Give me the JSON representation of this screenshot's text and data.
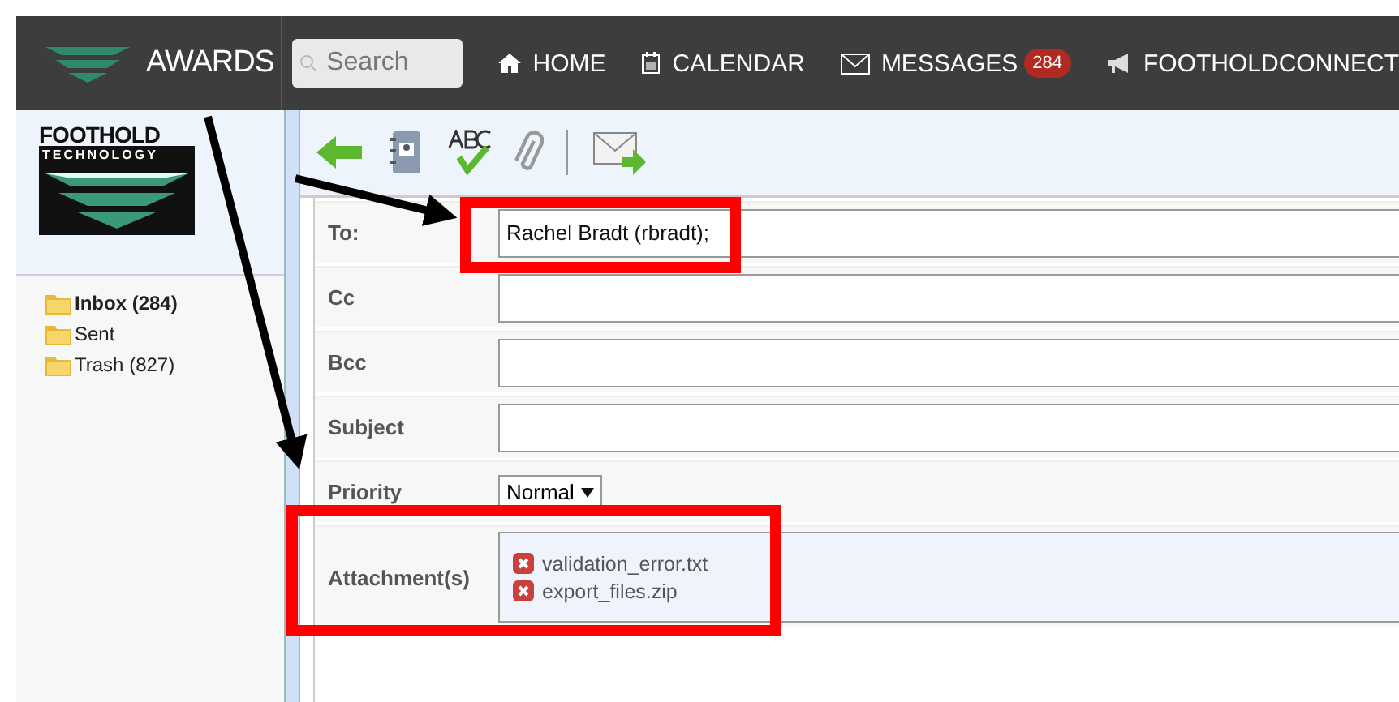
{
  "topbar": {
    "brand": "AWARDS",
    "search": {
      "placeholder": "Search"
    },
    "nav": [
      {
        "kind": "home",
        "label": "HOME"
      },
      {
        "kind": "calendar",
        "label": "CALENDAR"
      },
      {
        "kind": "messages",
        "label": "MESSAGES",
        "badge": "284"
      },
      {
        "kind": "connect",
        "label": "FOOTHOLDCONNECT"
      }
    ]
  },
  "sidebar": {
    "logo": {
      "line1": "FOOTHOLD",
      "line2": "TECHNOLOGY"
    },
    "folders": [
      {
        "name": "Inbox",
        "count": "(284)",
        "bold": true
      },
      {
        "name": "Sent",
        "bold": false
      },
      {
        "name": "Trash",
        "count": "(827)",
        "bold": false
      }
    ]
  },
  "toolbar": [
    {
      "kind": "back"
    },
    {
      "kind": "address-book"
    },
    {
      "kind": "spellcheck"
    },
    {
      "kind": "attach"
    },
    {
      "kind": "separator"
    },
    {
      "kind": "send"
    }
  ],
  "form": {
    "fields": [
      {
        "kind": "text",
        "label": "To:",
        "value": "Rachel Bradt (rbradt);",
        "highlighted": true
      },
      {
        "kind": "text",
        "label": "Cc"
      },
      {
        "kind": "text",
        "label": "Bcc"
      },
      {
        "kind": "text",
        "label": "Subject"
      },
      {
        "kind": "select",
        "label": "Priority",
        "value": "Normal"
      },
      {
        "kind": "attachments",
        "label": "Attachment(s)",
        "highlighted": true,
        "files": [
          "validation_error.txt",
          "export_files.zip"
        ]
      }
    ]
  }
}
